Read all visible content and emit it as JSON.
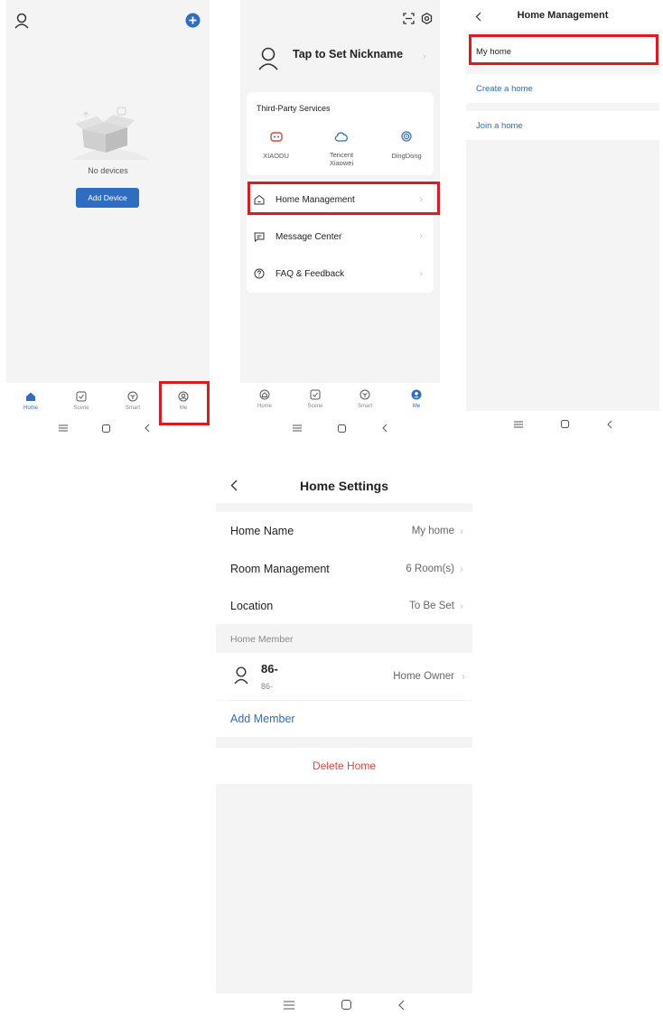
{
  "colors": {
    "accent": "#2f6dc0",
    "highlight": "#e0191e",
    "danger": "#e0443a"
  },
  "screen1": {
    "empty_text": "No devices",
    "add_device_button": "Add Device",
    "tabs": [
      {
        "label": "Home",
        "icon": "home-icon",
        "active": true
      },
      {
        "label": "Scene",
        "icon": "scene-icon",
        "active": false
      },
      {
        "label": "Smart",
        "icon": "smart-icon",
        "active": false
      },
      {
        "label": "Me",
        "icon": "me-icon",
        "active": false
      }
    ]
  },
  "screen2": {
    "nickname": "Tap to Set Nickname",
    "third_party": {
      "title": "Third-Party Services",
      "services": [
        {
          "label": "XIAODU",
          "icon": "xiaodu-icon"
        },
        {
          "label": "Tencent\nXiaowei",
          "icon": "tencent-xiaowei-icon"
        },
        {
          "label": "DingDong",
          "icon": "dingdong-icon"
        }
      ]
    },
    "menu": [
      {
        "label": "Home Management",
        "icon": "house-icon"
      },
      {
        "label": "Message Center",
        "icon": "message-icon"
      },
      {
        "label": "FAQ & Feedback",
        "icon": "question-icon"
      }
    ],
    "tabs": [
      {
        "label": "Home",
        "icon": "home-icon",
        "active": false
      },
      {
        "label": "Scene",
        "icon": "scene-icon",
        "active": false
      },
      {
        "label": "Smart",
        "icon": "smart-icon",
        "active": false
      },
      {
        "label": "Me",
        "icon": "me-icon",
        "active": true
      }
    ]
  },
  "screen3": {
    "title": "Home Management",
    "homes": [
      "My home"
    ],
    "create_home": "Create a home",
    "join_home": "Join a home"
  },
  "screen4": {
    "title": "Home Settings",
    "home_name_label": "Home Name",
    "home_name_value": "My home",
    "room_mgmt_label": "Room Management",
    "room_mgmt_value": "6 Room(s)",
    "location_label": "Location",
    "location_value": "To Be Set",
    "member_section": "Home Member",
    "member_name": "86-",
    "member_sub": "86-",
    "member_role": "Home Owner",
    "add_member": "Add Member",
    "delete_home": "Delete Home"
  }
}
